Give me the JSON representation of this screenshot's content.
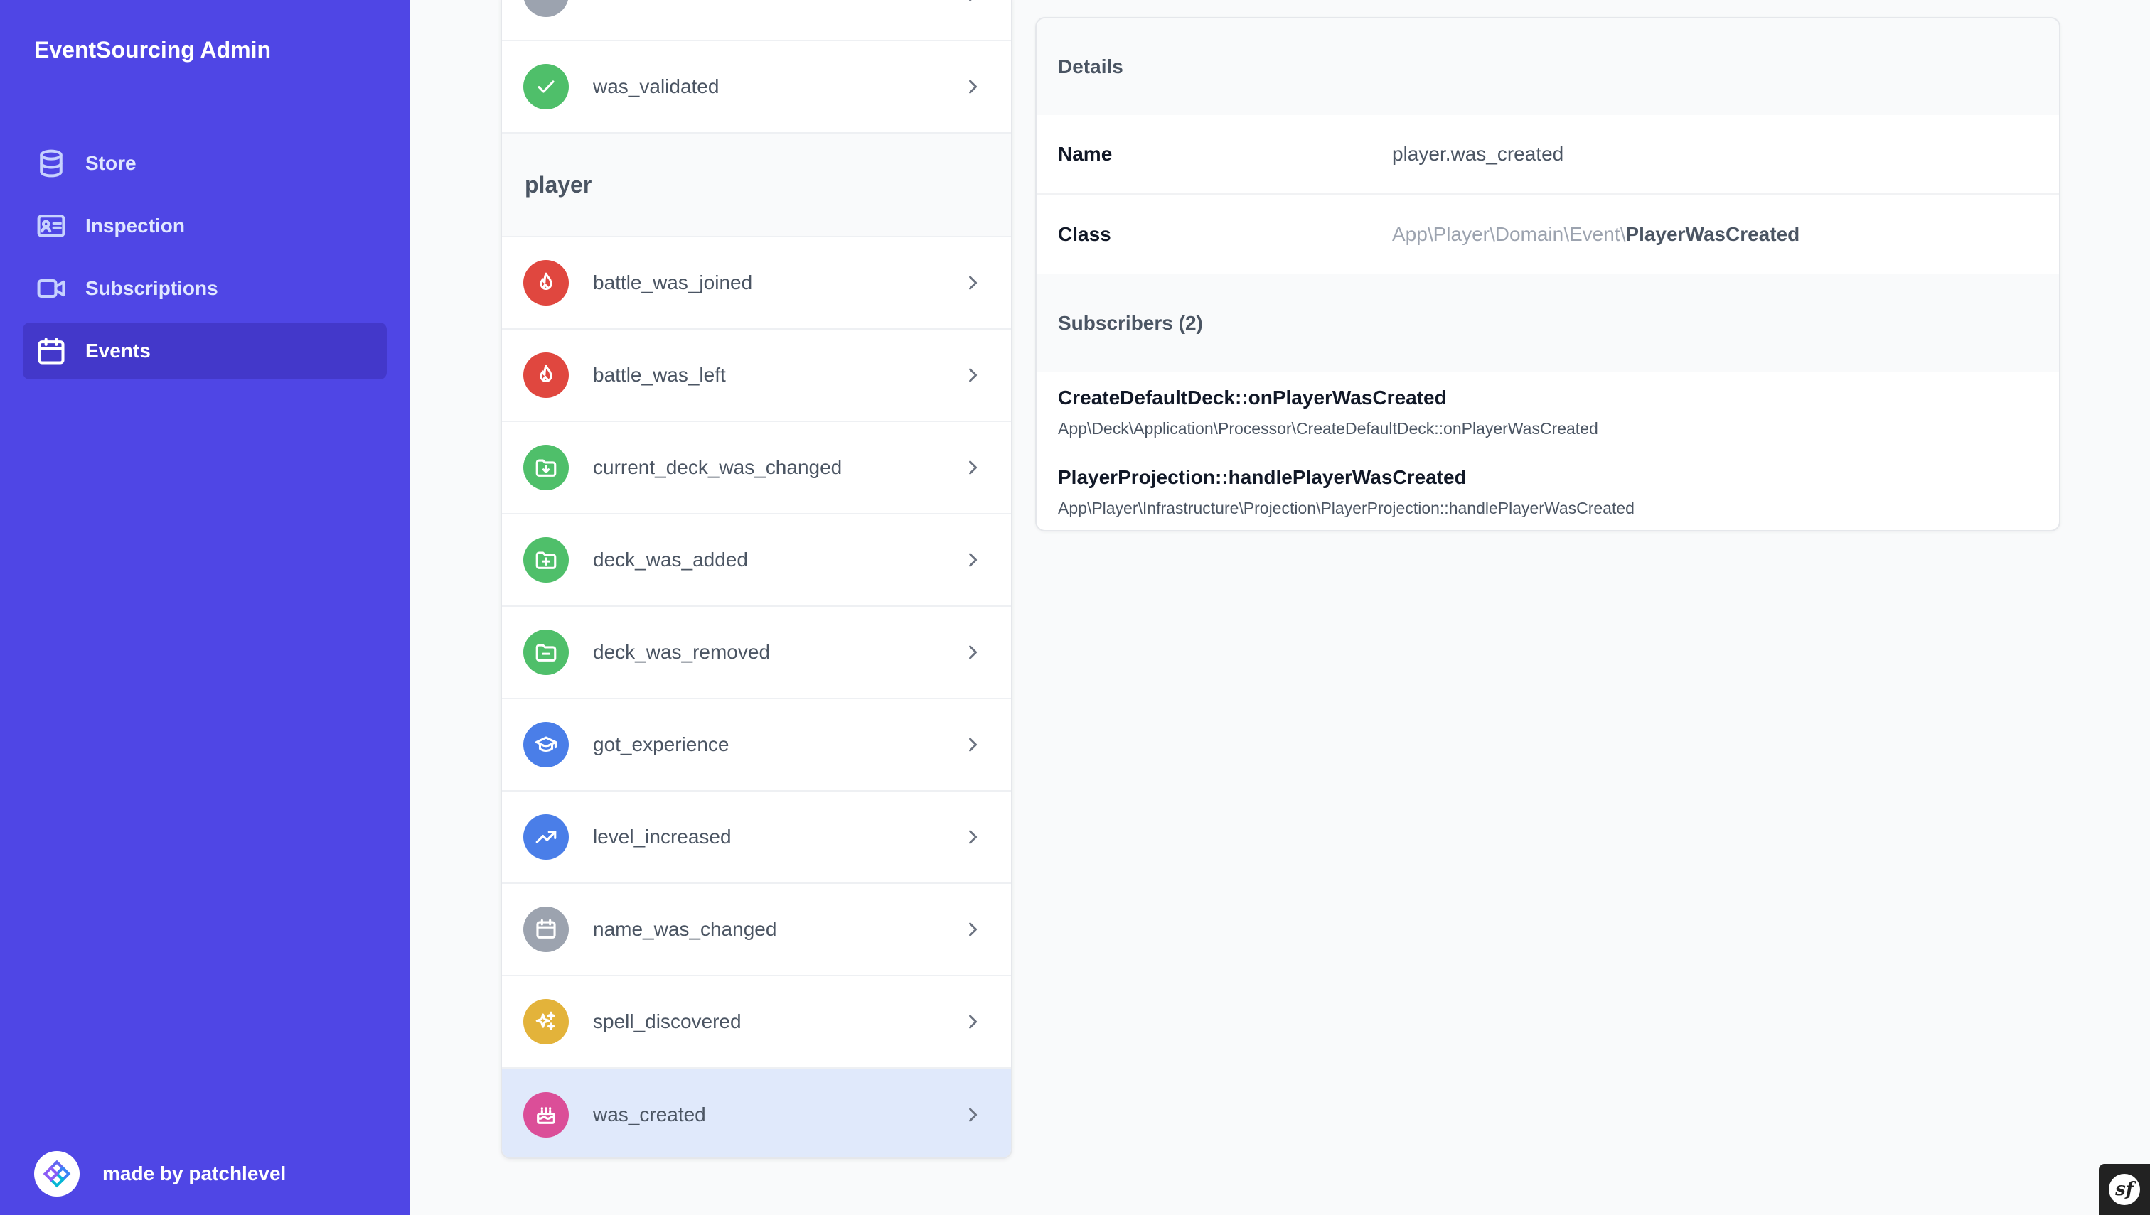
{
  "app": {
    "title": "EventSourcing Admin"
  },
  "nav": {
    "items": [
      {
        "label": "Store",
        "icon": "database-icon"
      },
      {
        "label": "Inspection",
        "icon": "id-card-icon"
      },
      {
        "label": "Subscriptions",
        "icon": "video-camera-icon"
      },
      {
        "label": "Events",
        "icon": "calendar-icon",
        "active": true
      }
    ]
  },
  "footer": {
    "text": "made by patchlevel"
  },
  "events": {
    "top_row": {
      "label": "was_validated",
      "icon": "check-icon",
      "color": "#4fbf6a"
    },
    "group": "player",
    "items": [
      {
        "label": "battle_was_joined",
        "icon": "fire-icon",
        "color": "#e0473f"
      },
      {
        "label": "battle_was_left",
        "icon": "fire-icon",
        "color": "#e0473f"
      },
      {
        "label": "current_deck_was_changed",
        "icon": "folder-arrow-down-icon",
        "color": "#4fbf6a"
      },
      {
        "label": "deck_was_added",
        "icon": "folder-plus-icon",
        "color": "#4fbf6a"
      },
      {
        "label": "deck_was_removed",
        "icon": "folder-minus-icon",
        "color": "#4fbf6a"
      },
      {
        "label": "got_experience",
        "icon": "academic-cap-icon",
        "color": "#4a7ee8"
      },
      {
        "label": "level_increased",
        "icon": "trending-up-icon",
        "color": "#4a7ee8"
      },
      {
        "label": "name_was_changed",
        "icon": "calendar-icon",
        "color": "#9ca3af"
      },
      {
        "label": "spell_discovered",
        "icon": "sparkles-icon",
        "color": "#e3b33a"
      },
      {
        "label": "was_created",
        "icon": "cake-icon",
        "color": "#db4e98",
        "selected": true
      }
    ]
  },
  "details": {
    "header": "Details",
    "name_label": "Name",
    "name_value": "player.was_created",
    "class_label": "Class",
    "class_namespace": "App\\Player\\Domain\\Event\\",
    "class_name": "PlayerWasCreated",
    "subscribers_header": "Subscribers (2)",
    "subscribers": [
      {
        "title": "CreateDefaultDeck::onPlayerWasCreated",
        "path": "App\\Deck\\Application\\Processor\\CreateDefaultDeck::onPlayerWasCreated"
      },
      {
        "title": "PlayerProjection::handlePlayerWasCreated",
        "path": "App\\Player\\Infrastructure\\Projection\\PlayerProjection::handlePlayerWasCreated"
      }
    ]
  },
  "colors": {
    "sidebar": "#4f46e5",
    "sidebar_active": "#4338ca",
    "selected_row": "#e0e9fb"
  }
}
